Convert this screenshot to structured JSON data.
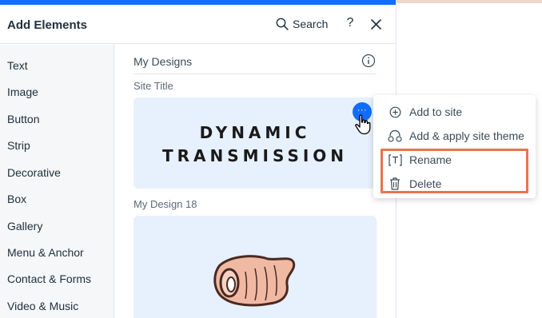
{
  "panel": {
    "title": "Add Elements",
    "search_label": "Search",
    "help_label": "?"
  },
  "sidebar": {
    "items": [
      {
        "label": "Text"
      },
      {
        "label": "Image"
      },
      {
        "label": "Button"
      },
      {
        "label": "Strip"
      },
      {
        "label": "Decorative"
      },
      {
        "label": "Box"
      },
      {
        "label": "Gallery"
      },
      {
        "label": "Menu & Anchor"
      },
      {
        "label": "Contact & Forms"
      },
      {
        "label": "Video & Music"
      }
    ]
  },
  "content": {
    "section_title": "My Designs",
    "designs": [
      {
        "label": "Site Title",
        "line1": "DYNAMIC",
        "line2": "TRANSMISSION"
      },
      {
        "label": "My Design 18"
      }
    ]
  },
  "more_button": {
    "label": "···"
  },
  "context_menu": {
    "items": [
      {
        "label": "Add to site",
        "icon": "plus-circle-icon"
      },
      {
        "label": "Add & apply site theme",
        "icon": "theme-icon"
      },
      {
        "label": "Rename",
        "icon": "rename-text-icon"
      },
      {
        "label": "Delete",
        "icon": "trash-icon"
      }
    ]
  },
  "colors": {
    "accent": "#116dff",
    "card_bg": "#e7f0fd",
    "highlight": "#e8744b",
    "sidebar_bg": "#f5f7f9"
  }
}
